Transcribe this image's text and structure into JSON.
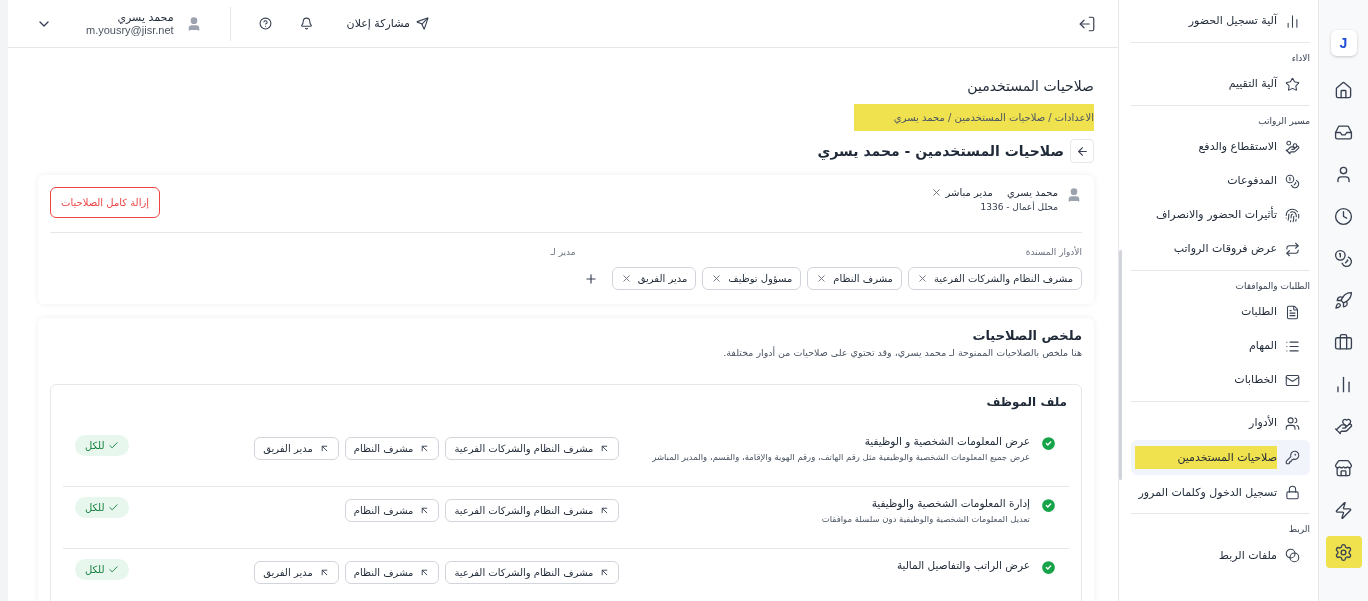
{
  "header": {
    "user_name": "محمد يسري",
    "user_email": "m.yousry@jisr.net",
    "share_button": "مشاركة إعلان"
  },
  "page": {
    "title": "صلاحيات المستخدمين",
    "breadcrumb": {
      "text": "الاعدادات / صلاحيات المستخدمين / محمد يسري",
      "highlighted": true
    },
    "heading": "صلاحيات المستخدمين - محمد يسري"
  },
  "user_card": {
    "name": "محمد يسري",
    "tag": "مدير مباشر",
    "subtitle": "محلل أعمال - 1336",
    "remove_button": "إزالة كامل الصلاحيات",
    "roles_label": "الأدوار المسندة",
    "manager_label": "مدير لـ",
    "roles": [
      "مشرف النظام والشركات الفرعية",
      "مشرف النظام",
      "مسؤول توظيف",
      "مدير الفريق"
    ]
  },
  "summary": {
    "title": "ملخص الصلاحيات",
    "description": "هنا ملخص بالصلاحيات الممنوحة لـ محمد يسري، وقد تحتوي على صلاحيات من أدوار مختلفة.",
    "sections": [
      {
        "title": "ملف الموظف",
        "rows": [
          {
            "title": "عرض المعلومات الشخصية و الوظيفية",
            "description": "عرض جميع المعلومات الشخصية والوظيفية مثل رقم الهاتف، ورقم الهوية والإقامة، والقسم، والمدير المباشر",
            "granted": true,
            "roles": [
              "مشرف النظام والشركات الفرعية",
              "مشرف النظام",
              "مدير الفريق"
            ],
            "scope": "للكل"
          },
          {
            "title": "إدارة المعلومات الشخصية والوظيفية",
            "description": "تعديل المعلومات الشخصية والوظيفية دون سلسلة موافقات",
            "granted": true,
            "roles": [
              "مشرف النظام والشركات الفرعية",
              "مشرف النظام"
            ],
            "scope": "للكل"
          },
          {
            "title": "عرض الراتب والتفاصيل المالية",
            "granted": true,
            "roles": [
              "مشرف النظام والشركات الفرعية",
              "مشرف النظام",
              "مدير الفريق"
            ],
            "scope": "للكل"
          }
        ]
      }
    ]
  },
  "sidebar": {
    "sections": [
      {
        "items": [
          {
            "label": "آلية تسجيل الحضور",
            "selected": false,
            "highlighted": false
          }
        ]
      },
      {
        "title": "الاداء",
        "items": [
          {
            "label": "آلية التقييم",
            "selected": false,
            "highlighted": false
          }
        ]
      },
      {
        "title": "مسير الرواتب",
        "items": [
          {
            "label": "الاستقطاع والدفع",
            "selected": false,
            "highlighted": false
          },
          {
            "label": "المدفوعات",
            "selected": false,
            "highlighted": false
          },
          {
            "label": "تأثيرات الحضور والانصراف",
            "selected": false,
            "highlighted": false
          },
          {
            "label": "عرض فروقات الرواتب",
            "selected": false,
            "highlighted": false
          }
        ]
      },
      {
        "title": "الطلبات والموافقات",
        "items": [
          {
            "label": "الطلبات",
            "selected": false,
            "highlighted": false
          },
          {
            "label": "المهام",
            "selected": false,
            "highlighted": false
          },
          {
            "label": "الخطابات",
            "selected": false,
            "highlighted": false
          }
        ]
      },
      {
        "items": [
          {
            "label": "الأدوار",
            "selected": false,
            "highlighted": false
          },
          {
            "label": "صلاحيات المستخدمين",
            "selected": true,
            "highlighted": true
          },
          {
            "label": "تسجيل الدخول وكلمات المرور",
            "selected": false,
            "highlighted": false
          }
        ]
      },
      {
        "title": "الربط",
        "items": [
          {
            "label": "ملفات الربط",
            "selected": false,
            "highlighted": false
          }
        ]
      }
    ]
  },
  "rail": {
    "logo": "J",
    "items": [
      {
        "highlighted": false
      },
      {
        "highlighted": false
      },
      {
        "highlighted": false
      },
      {
        "highlighted": false
      },
      {
        "highlighted": false
      },
      {
        "highlighted": false
      },
      {
        "highlighted": false
      },
      {
        "highlighted": false
      },
      {
        "highlighted": false
      },
      {
        "highlighted": false
      },
      {
        "highlighted": false
      },
      {
        "highlighted": true
      }
    ]
  }
}
